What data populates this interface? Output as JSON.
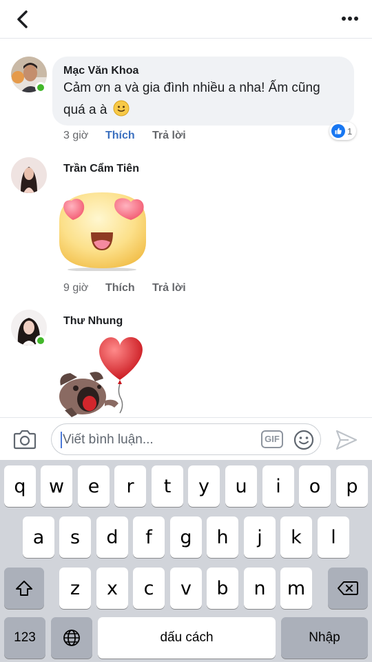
{
  "header": {
    "back_icon": "chevron-left-icon",
    "more_icon": "more-horizontal-icon"
  },
  "comments": [
    {
      "author": "Mạc Văn Khoa",
      "online": true,
      "text_line1": "Cảm ơn a và gia đình nhiều a nha! Ấm cũng",
      "text_line2": "quá a à",
      "emoji": "🙂",
      "time": "3 giờ",
      "like_label": "Thích",
      "reply_label": "Trả lời",
      "reaction_count": "1",
      "reaction_icon": "thumbs-up-icon"
    },
    {
      "author": "Trần Cẩm Tiên",
      "online": false,
      "sticker": "heart-eyes-face",
      "time": "9 giờ",
      "like_label": "Thích",
      "reply_label": "Trả lời"
    },
    {
      "author": "Thư Nhung",
      "online": true,
      "sticker": "dog-with-heart-balloon"
    }
  ],
  "composer": {
    "placeholder": "Viết bình luận...",
    "gif_label": "GIF",
    "camera_icon": "camera-icon",
    "emoji_icon": "smiley-icon",
    "send_icon": "send-icon"
  },
  "keyboard": {
    "row1": [
      "q",
      "w",
      "e",
      "r",
      "t",
      "y",
      "u",
      "i",
      "o",
      "p"
    ],
    "row2": [
      "a",
      "s",
      "d",
      "f",
      "g",
      "h",
      "j",
      "k",
      "l"
    ],
    "row3": [
      "z",
      "x",
      "c",
      "v",
      "b",
      "n",
      "m"
    ],
    "numbers_label": "123",
    "space_label": "dấu cách",
    "return_label": "Nhập",
    "shift_icon": "shift-icon",
    "delete_icon": "backspace-icon",
    "globe_icon": "globe-icon"
  },
  "colors": {
    "accent": "#3a6fbf",
    "online": "#42b72a",
    "bubble": "#f0f2f5",
    "keyboard_bg": "#d1d4da"
  }
}
